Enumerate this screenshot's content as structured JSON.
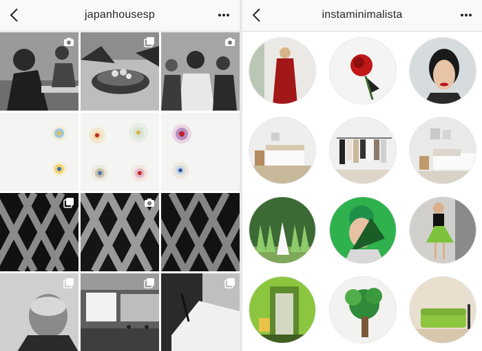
{
  "left_panel": {
    "title": "japanhousesp",
    "back_icon": "chevron-left-icon",
    "more_icon": "more-horizontal-icon",
    "tiles": [
      {
        "caption": "",
        "badge": "camera-icon"
      },
      {
        "caption": "",
        "badge": "multi-photo-icon"
      },
      {
        "caption": "",
        "badge": "camera-icon"
      },
      {
        "caption": "",
        "badge": "none"
      },
      {
        "caption": "",
        "badge": "none"
      },
      {
        "caption": "",
        "badge": "none"
      },
      {
        "caption": "",
        "badge": "multi-photo-icon"
      },
      {
        "caption": "",
        "badge": "camera-icon"
      },
      {
        "caption": "",
        "badge": "multi-photo-icon"
      },
      {
        "caption": "",
        "badge": "multi-photo-icon"
      },
      {
        "caption": "",
        "badge": "multi-photo-icon"
      },
      {
        "caption": "",
        "badge": "multi-photo-icon"
      }
    ]
  },
  "right_panel": {
    "title": "instaminimalista",
    "back_icon": "chevron-left-icon",
    "more_icon": "more-horizontal-icon",
    "accent_colors": [
      "#b5121b",
      "#2ea84a",
      "#6fbf3b",
      "#8cc63f"
    ]
  }
}
